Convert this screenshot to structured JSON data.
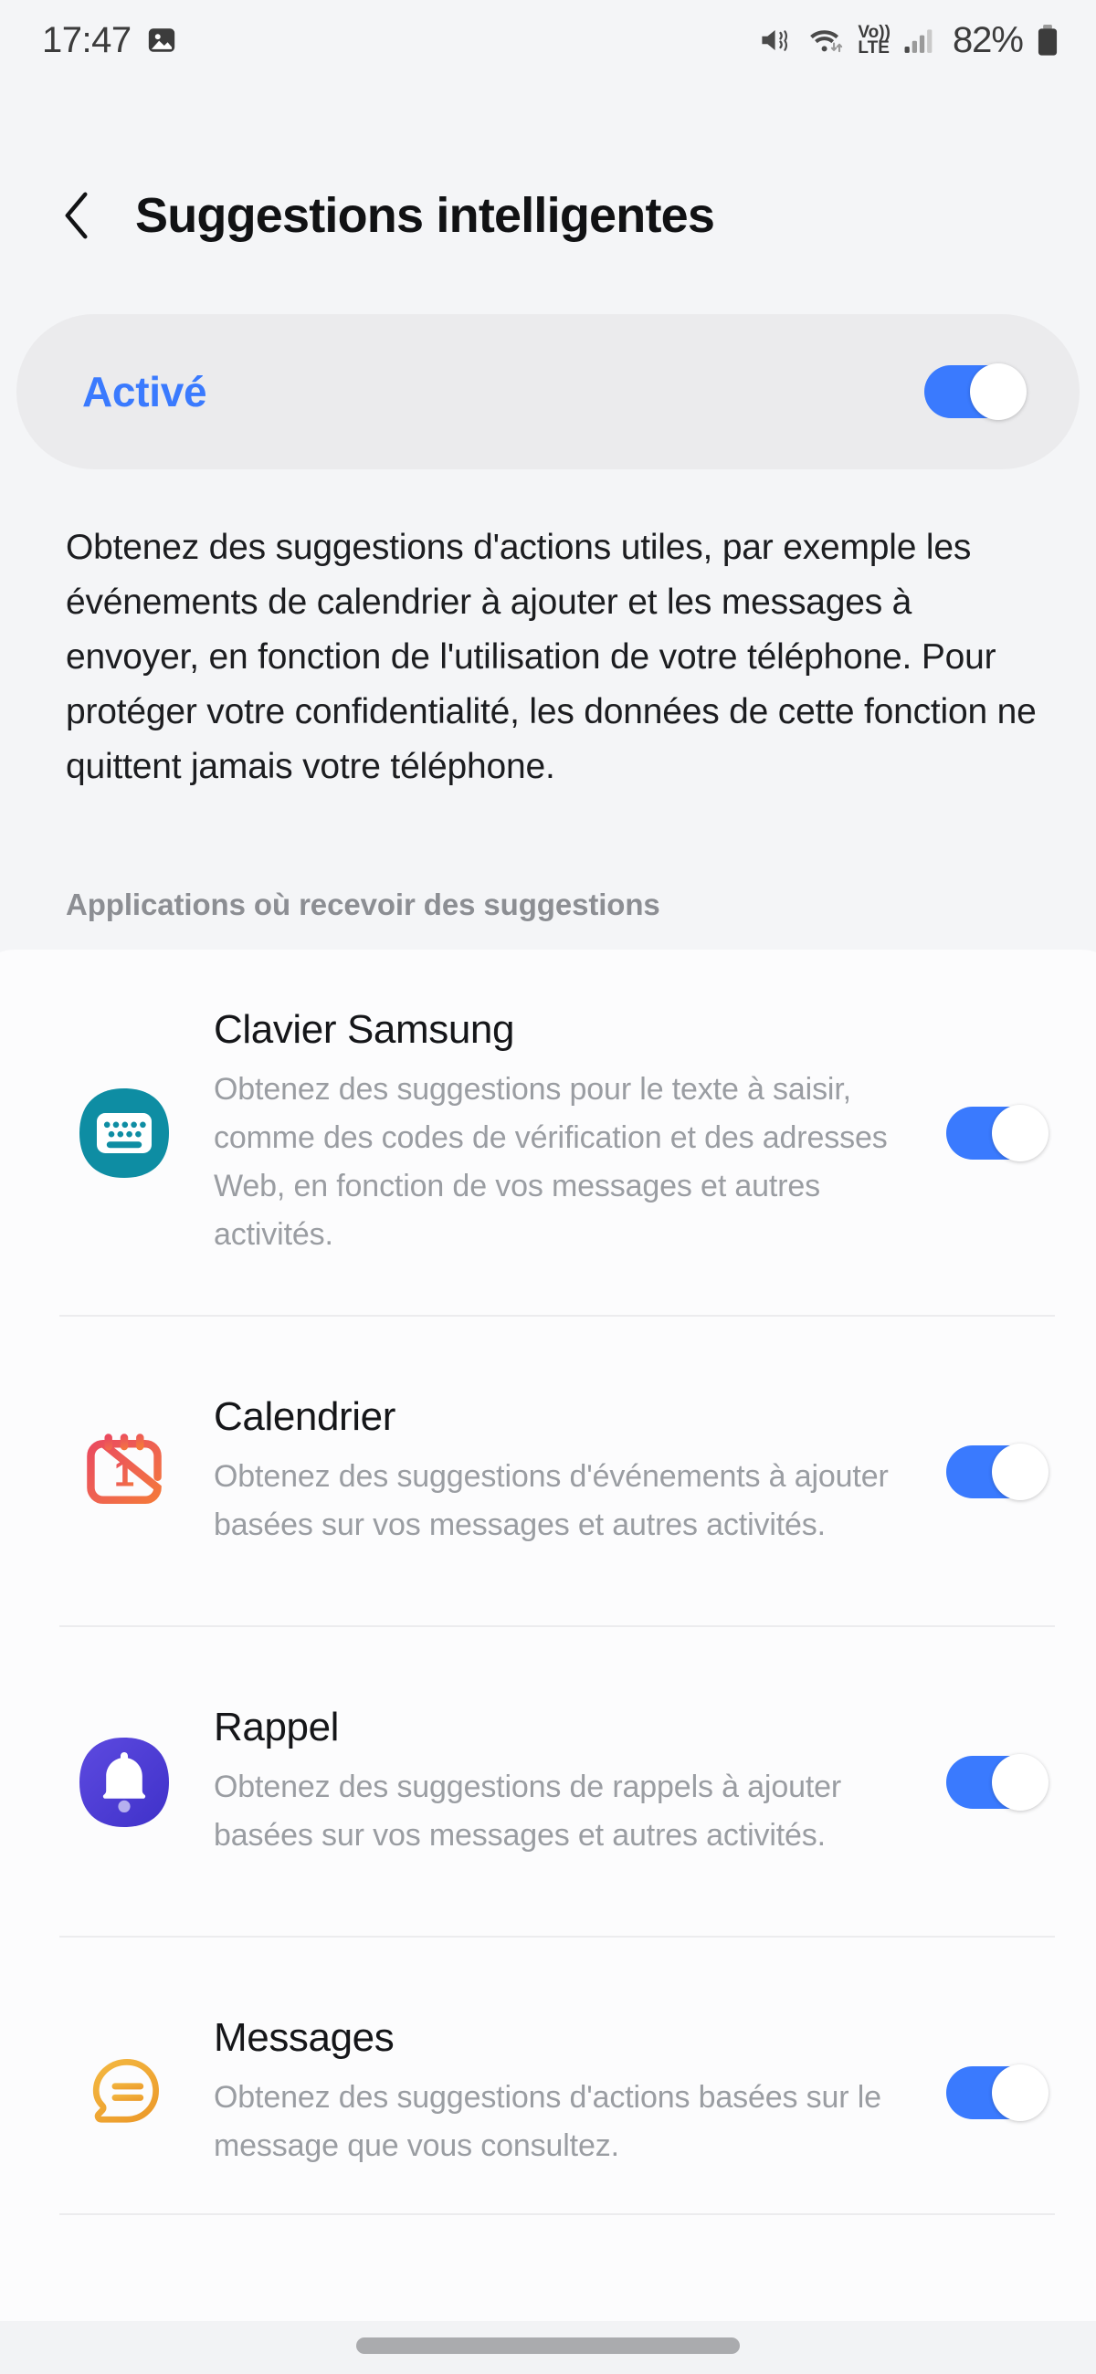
{
  "status_bar": {
    "time": "17:47",
    "battery_percent": "82%",
    "icons": [
      "gallery-image-icon",
      "mute-vibrate-icon",
      "wifi-icon",
      "volte-icon",
      "signal-bars-icon",
      "battery-icon"
    ],
    "volte_label_top": "Vo))",
    "volte_label_bottom": "LTE"
  },
  "header": {
    "back_label": "back-chevron",
    "title": "Suggestions intelligentes"
  },
  "master_toggle": {
    "label": "Activé",
    "state": "on",
    "accent_color": "#3a7afe"
  },
  "description": "Obtenez des suggestions d'actions utiles, par exemple les événements de calendrier à ajouter et les messages à envoyer, en fonction de l'utilisation de votre téléphone. Pour protéger votre confidentialité, les données de cette fonction ne quittent jamais votre téléphone.",
  "section": {
    "title": "Applications où recevoir des suggestions"
  },
  "apps": [
    {
      "name": "Clavier Samsung",
      "description": "Obtenez des suggestions pour le texte à saisir, comme des codes de vérification et des adresses Web, en fonction de vos messages et autres activités.",
      "icon": "samsung-keyboard-icon",
      "icon_color": "#0e8da3",
      "toggle_state": "on"
    },
    {
      "name": "Calendrier",
      "description": "Obtenez des suggestions d'événements à ajouter basées sur vos messages et autres activités.",
      "icon": "calendar-icon",
      "icon_color": "#ea4b5e",
      "icon_color_2": "#f4783a",
      "icon_day_number": "1",
      "toggle_state": "on"
    },
    {
      "name": "Rappel",
      "description": "Obtenez des suggestions de rappels à ajouter basées sur vos messages et autres activités.",
      "icon": "reminder-bell-icon",
      "icon_color": "#4b3fd4",
      "toggle_state": "on"
    },
    {
      "name": "Messages",
      "description": "Obtenez des suggestions d'actions basées sur le message que vous consultez.",
      "icon": "messages-bubble-icon",
      "icon_color": "#efa633",
      "toggle_state": "on"
    }
  ],
  "colors": {
    "page_background": "#f4f5f7",
    "card_background": "#fcfcfd",
    "master_card_background": "#ebebed",
    "accent": "#3a7afe",
    "title_text": "#111214",
    "body_text": "#1c1d20",
    "muted_text": "#9a9da2",
    "section_text": "#8c8e93",
    "divider": "#ececee"
  }
}
